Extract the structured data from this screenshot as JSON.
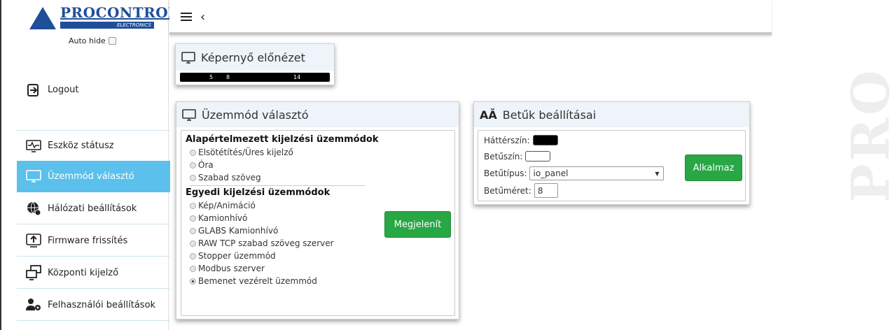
{
  "logo": {
    "brand": "PROCONTROL",
    "sub": "ELECTRONICS"
  },
  "autohide": {
    "label": "Auto hide"
  },
  "sidebar": {
    "logout": "Logout",
    "items": [
      {
        "label": "Eszköz státusz",
        "icon": "pulse-monitor-icon"
      },
      {
        "label": "Üzemmód választó",
        "icon": "monitor-icon"
      },
      {
        "label": "Hálózati beállítások",
        "icon": "network-gear-icon"
      },
      {
        "label": "Firmware frissítés",
        "icon": "upload-icon"
      },
      {
        "label": "Központi kijelző",
        "icon": "multi-monitor-icon"
      },
      {
        "label": "Felhasználói beállítások",
        "icon": "user-gear-icon"
      }
    ]
  },
  "preview": {
    "title": "Képernyő előnézet",
    "values": [
      "5",
      "8",
      "14"
    ]
  },
  "mode": {
    "title": "Üzemmód választó",
    "group1": "Alapértelmezett kijelzési üzemmódok",
    "options1": [
      "Elsötétítés/Üres kijelző",
      "Óra",
      "Szabad szöveg"
    ],
    "group2": "Egyedi kijelzési üzemmódok",
    "options2": [
      "Kép/Animáció",
      "Kamionhívó",
      "GLABS Kamionhívó",
      "RAW TCP szabad szöveg szerver",
      "Stopper üzemmód",
      "Modbus szerver",
      "Bemenet vezérelt üzemmód"
    ],
    "selected": "Bemenet vezérelt üzemmód",
    "button": "Megjelenít"
  },
  "font": {
    "title": "Betűk beállításai",
    "bg_label": "Háttérszín:",
    "bg_color": "#000000",
    "fg_label": "Betűszín:",
    "fg_color": "#ffffff",
    "type_label": "Betűtípus:",
    "type_value": "io_panel",
    "size_label": "Betűméret:",
    "size_value": "8",
    "button": "Alkalmaz"
  },
  "watermark": "PRO",
  "colors": {
    "accent": "#5bc0eb",
    "green": "#28a745",
    "brand": "#1f4f99"
  }
}
